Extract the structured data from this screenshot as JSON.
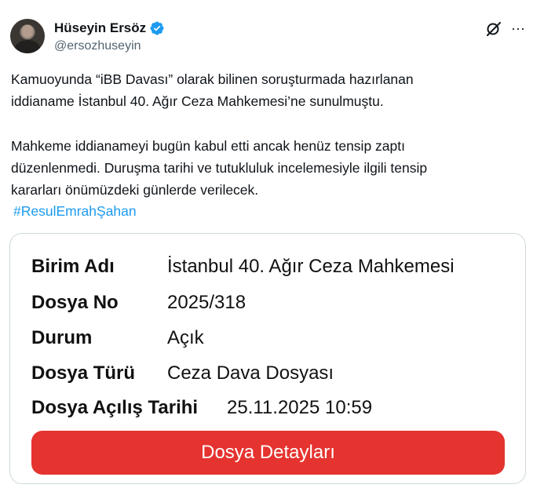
{
  "author": {
    "display_name": "Hüseyin Ersöz",
    "handle": "@ersozhuseyin"
  },
  "icons": {
    "verified": "verified-badge-icon",
    "grok": "grok-icon",
    "more": "more-icon"
  },
  "more_label": "···",
  "tweet": {
    "paragraph_1_line_1": "Kamuoyunda “iBB Davası” olarak bilinen soruşturmada hazırlanan",
    "paragraph_1_line_2": "iddianame İstanbul 40. Ağır Ceza Mahkemesi’ne sunulmuştu.",
    "paragraph_2_line_1": "Mahkeme iddianameyi bugün kabul etti ancak henüz tensip zaptı",
    "paragraph_2_line_2": "düzenlenmedi. Duruşma tarihi ve tutukluluk incelemesiyle ilgili tensip",
    "paragraph_2_line_3": "kararları önümüzdeki günlerde verilecek.",
    "hashtag": "#ResulEmrahŞahan"
  },
  "card": {
    "rows": [
      {
        "label": "Birim Adı",
        "value": "İstanbul 40. Ağır Ceza Mahkemesi"
      },
      {
        "label": "Dosya No",
        "value": "2025/318"
      },
      {
        "label": "Durum",
        "value": "Açık"
      },
      {
        "label": "Dosya Türü",
        "value": "Ceza Dava Dosyası"
      },
      {
        "label": "Dosya Açılış Tarihi",
        "value": "25.11.2025 10:59"
      }
    ],
    "button_label": "Dosya Detayları"
  },
  "colors": {
    "verified": "#1d9bf0",
    "hashtag": "#1d9bf0",
    "button": "#e5332f",
    "secondary_text": "#536471"
  }
}
